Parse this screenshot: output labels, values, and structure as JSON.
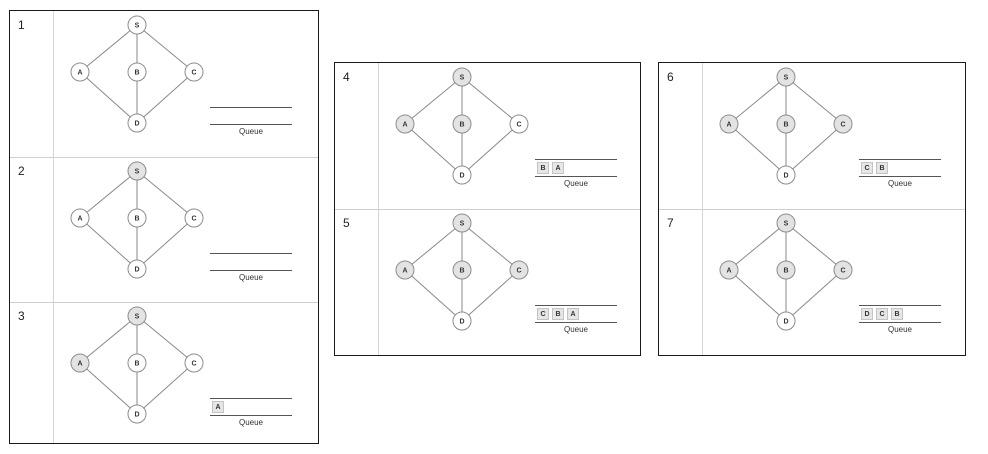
{
  "queue_label": "Queue",
  "colors": {
    "visited": "#e3e3e3",
    "unvisited": "#ffffff"
  },
  "nodes": [
    "S",
    "A",
    "B",
    "C",
    "D"
  ],
  "edges": [
    [
      "S",
      "A"
    ],
    [
      "S",
      "B"
    ],
    [
      "S",
      "C"
    ],
    [
      "A",
      "D"
    ],
    [
      "B",
      "D"
    ],
    [
      "C",
      "D"
    ]
  ],
  "steps": [
    {
      "num": "1",
      "visited": [],
      "queue": []
    },
    {
      "num": "2",
      "visited": [
        "S"
      ],
      "queue": []
    },
    {
      "num": "3",
      "visited": [
        "S",
        "A"
      ],
      "queue": [
        "A"
      ]
    },
    {
      "num": "4",
      "visited": [
        "S",
        "A",
        "B"
      ],
      "queue": [
        "B",
        "A"
      ]
    },
    {
      "num": "5",
      "visited": [
        "S",
        "A",
        "B",
        "C"
      ],
      "queue": [
        "C",
        "B",
        "A"
      ]
    },
    {
      "num": "6",
      "visited": [
        "S",
        "A",
        "B",
        "C"
      ],
      "queue": [
        "C",
        "B"
      ]
    },
    {
      "num": "7",
      "visited": [
        "S",
        "A",
        "B",
        "C"
      ],
      "queue": [
        "D",
        "C",
        "B"
      ]
    }
  ]
}
